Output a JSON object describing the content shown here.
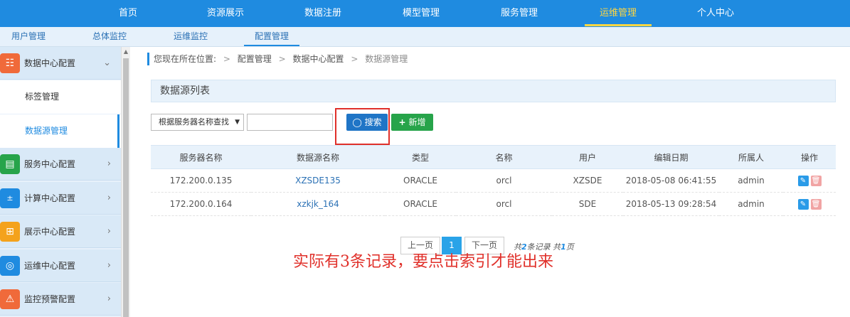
{
  "topnav": {
    "items": [
      "首页",
      "资源展示",
      "数据注册",
      "模型管理",
      "服务管理",
      "运维管理",
      "个人中心"
    ],
    "active": "运维管理"
  },
  "subnav": {
    "items": [
      "用户管理",
      "总体监控",
      "运维监控",
      "配置管理"
    ],
    "active": "配置管理"
  },
  "sidebar": {
    "groups": [
      {
        "label": "数据中心配置",
        "icon": "database-icon",
        "color": "#f06a3a",
        "expanded": true
      },
      {
        "label": "服务中心配置",
        "icon": "server-icon",
        "color": "#27a44a"
      },
      {
        "label": "计算中心配置",
        "icon": "calculator-icon",
        "color": "#1f8be0"
      },
      {
        "label": "展示中心配置",
        "icon": "grid-icon",
        "color": "#f4a21c"
      },
      {
        "label": "运维中心配置",
        "icon": "target-icon",
        "color": "#1f8be0"
      },
      {
        "label": "监控预警配置",
        "icon": "alarm-icon",
        "color": "#f06a3a"
      }
    ],
    "sub_items": [
      "标签管理",
      "数据源管理"
    ],
    "active_sub": "数据源管理"
  },
  "breadcrumb": {
    "prefix": "您现在所在位置:",
    "sep": ">",
    "items": [
      "配置管理",
      "数据中心配置",
      "数据源管理"
    ]
  },
  "panel": {
    "title": "数据源列表"
  },
  "search": {
    "select_value": "根据服务器名称查找",
    "input_value": "",
    "search_label": "搜索",
    "add_label": "新增"
  },
  "table": {
    "columns": [
      "服务器名称",
      "数据源名称",
      "类型",
      "名称",
      "用户",
      "编辑日期",
      "所属人",
      "操作"
    ],
    "rows": [
      [
        "172.200.0.135",
        "XZSDE135",
        "ORACLE",
        "orcl",
        "XZSDE",
        "2018-05-08 06:41:55",
        "admin"
      ],
      [
        "172.200.0.164",
        "xzkjk_164",
        "ORACLE",
        "orcl",
        "SDE",
        "2018-05-13 09:28:54",
        "admin"
      ]
    ]
  },
  "pagination": {
    "prev": "上一页",
    "current": "1",
    "next": "下一页",
    "total_prefix": "共",
    "total_records": "2",
    "total_records_suffix": "条记录",
    "total_pages_prefix": "共",
    "total_pages": "1",
    "total_pages_suffix": "页"
  },
  "annotation": {
    "text": "实际有3条记录，要点击索引才能出来",
    "color": "#e0302a"
  }
}
